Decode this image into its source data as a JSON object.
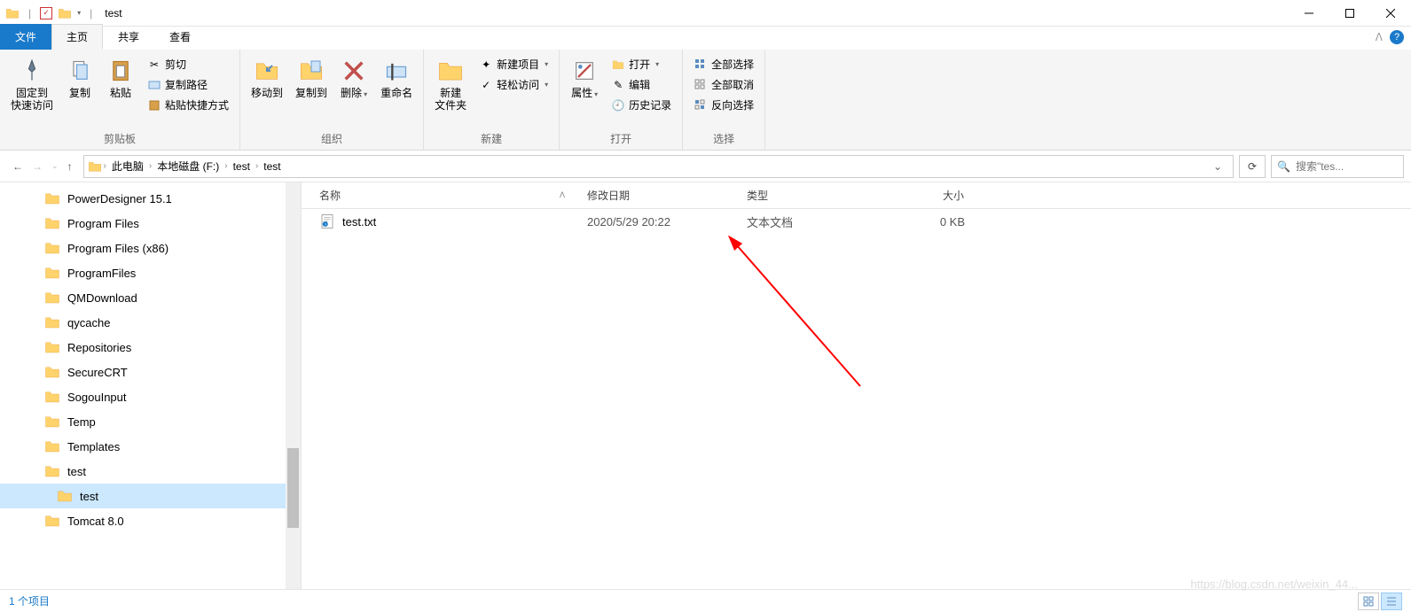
{
  "title": "test",
  "tabs": {
    "file": "文件",
    "home": "主页",
    "share": "共享",
    "view": "查看"
  },
  "ribbon": {
    "clipboard": {
      "label": "剪贴板",
      "pin": "固定到\n快速访问",
      "copy": "复制",
      "paste": "粘贴",
      "cut": "剪切",
      "copypath": "复制路径",
      "pasteshortcut": "粘贴快捷方式"
    },
    "organize": {
      "label": "组织",
      "moveto": "移动到",
      "copyto": "复制到",
      "delete": "删除",
      "rename": "重命名"
    },
    "new": {
      "label": "新建",
      "newfolder": "新建\n文件夹",
      "newitem": "新建项目",
      "easyaccess": "轻松访问"
    },
    "open": {
      "label": "打开",
      "properties": "属性",
      "open": "打开",
      "edit": "编辑",
      "history": "历史记录"
    },
    "select": {
      "label": "选择",
      "selectall": "全部选择",
      "selectnone": "全部取消",
      "invert": "反向选择"
    }
  },
  "breadcrumb": {
    "pc": "此电脑",
    "drive": "本地磁盘 (F:)",
    "d1": "test",
    "d2": "test"
  },
  "search_placeholder": "搜索\"tes...",
  "columns": {
    "name": "名称",
    "date": "修改日期",
    "type": "类型",
    "size": "大小"
  },
  "tree": [
    {
      "label": "PowerDesigner 15.1",
      "indent": false
    },
    {
      "label": "Program Files",
      "indent": false
    },
    {
      "label": "Program Files (x86)",
      "indent": false
    },
    {
      "label": "ProgramFiles",
      "indent": false
    },
    {
      "label": "QMDownload",
      "indent": false
    },
    {
      "label": "qycache",
      "indent": false
    },
    {
      "label": "Repositories",
      "indent": false
    },
    {
      "label": "SecureCRT",
      "indent": false
    },
    {
      "label": "SogouInput",
      "indent": false
    },
    {
      "label": "Temp",
      "indent": false
    },
    {
      "label": "Templates",
      "indent": false
    },
    {
      "label": "test",
      "indent": false
    },
    {
      "label": "test",
      "indent": true,
      "selected": true
    },
    {
      "label": "Tomcat  8.0",
      "indent": false
    }
  ],
  "files": [
    {
      "name": "test.txt",
      "date": "2020/5/29 20:22",
      "type": "文本文档",
      "size": "0 KB"
    }
  ],
  "status": "1 个项目",
  "watermark": "https://blog.csdn.net/weixin_44..."
}
